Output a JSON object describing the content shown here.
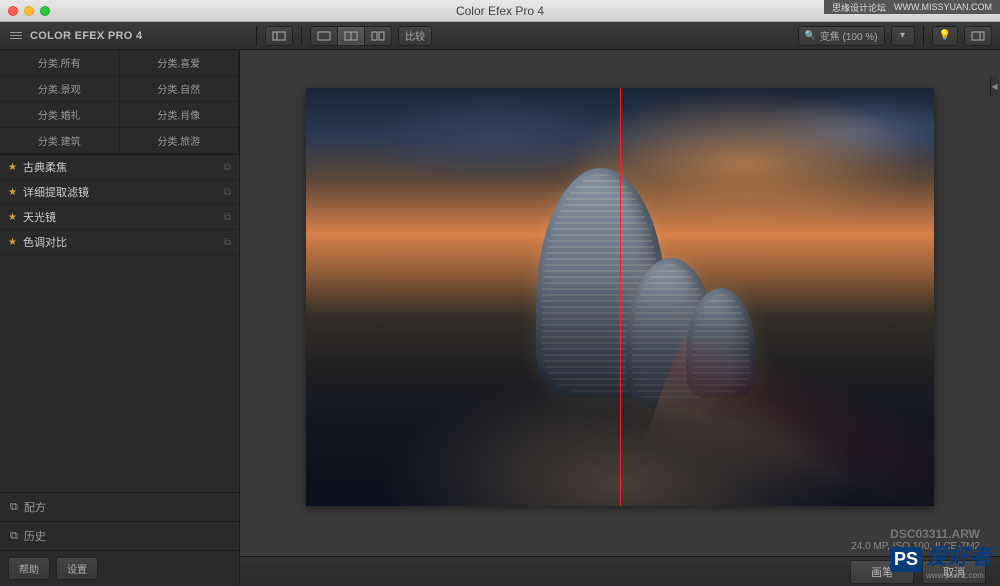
{
  "window": {
    "title": "Color Efex Pro 4"
  },
  "watermark": {
    "top_left": "思缘设计论坛",
    "top_right": "WWW.MISSYUAN.COM",
    "bottom_badge": "PS",
    "bottom_text": "爱好者",
    "bottom_sub": "www.psahz.com"
  },
  "toolbar": {
    "app_title": "COLOR EFEX PRO 4",
    "compare_label": "比较",
    "zoom_label": "变焦 (100 %)"
  },
  "categories": [
    "分类.所有",
    "分类.喜爱",
    "分类.景观",
    "分类.自然",
    "分类.婚礼",
    "分类.肖像",
    "分类.建筑",
    "分类.旅游"
  ],
  "filters": [
    {
      "star": true,
      "name": "古典柔焦"
    },
    {
      "star": true,
      "name": "详细提取滤镜"
    },
    {
      "star": true,
      "name": "天光镜"
    },
    {
      "star": true,
      "name": "色调对比"
    }
  ],
  "sidebar_sections": {
    "recipe": "配方",
    "history": "历史"
  },
  "sidebar_buttons": {
    "help": "帮助",
    "settings": "设置"
  },
  "image_info": {
    "filename": "DSC03311.ARW",
    "meta": "24.0 MP, ISO 100, ILCE-7M2"
  },
  "bottom_actions": {
    "brush": "画笔",
    "cancel": "取消"
  }
}
